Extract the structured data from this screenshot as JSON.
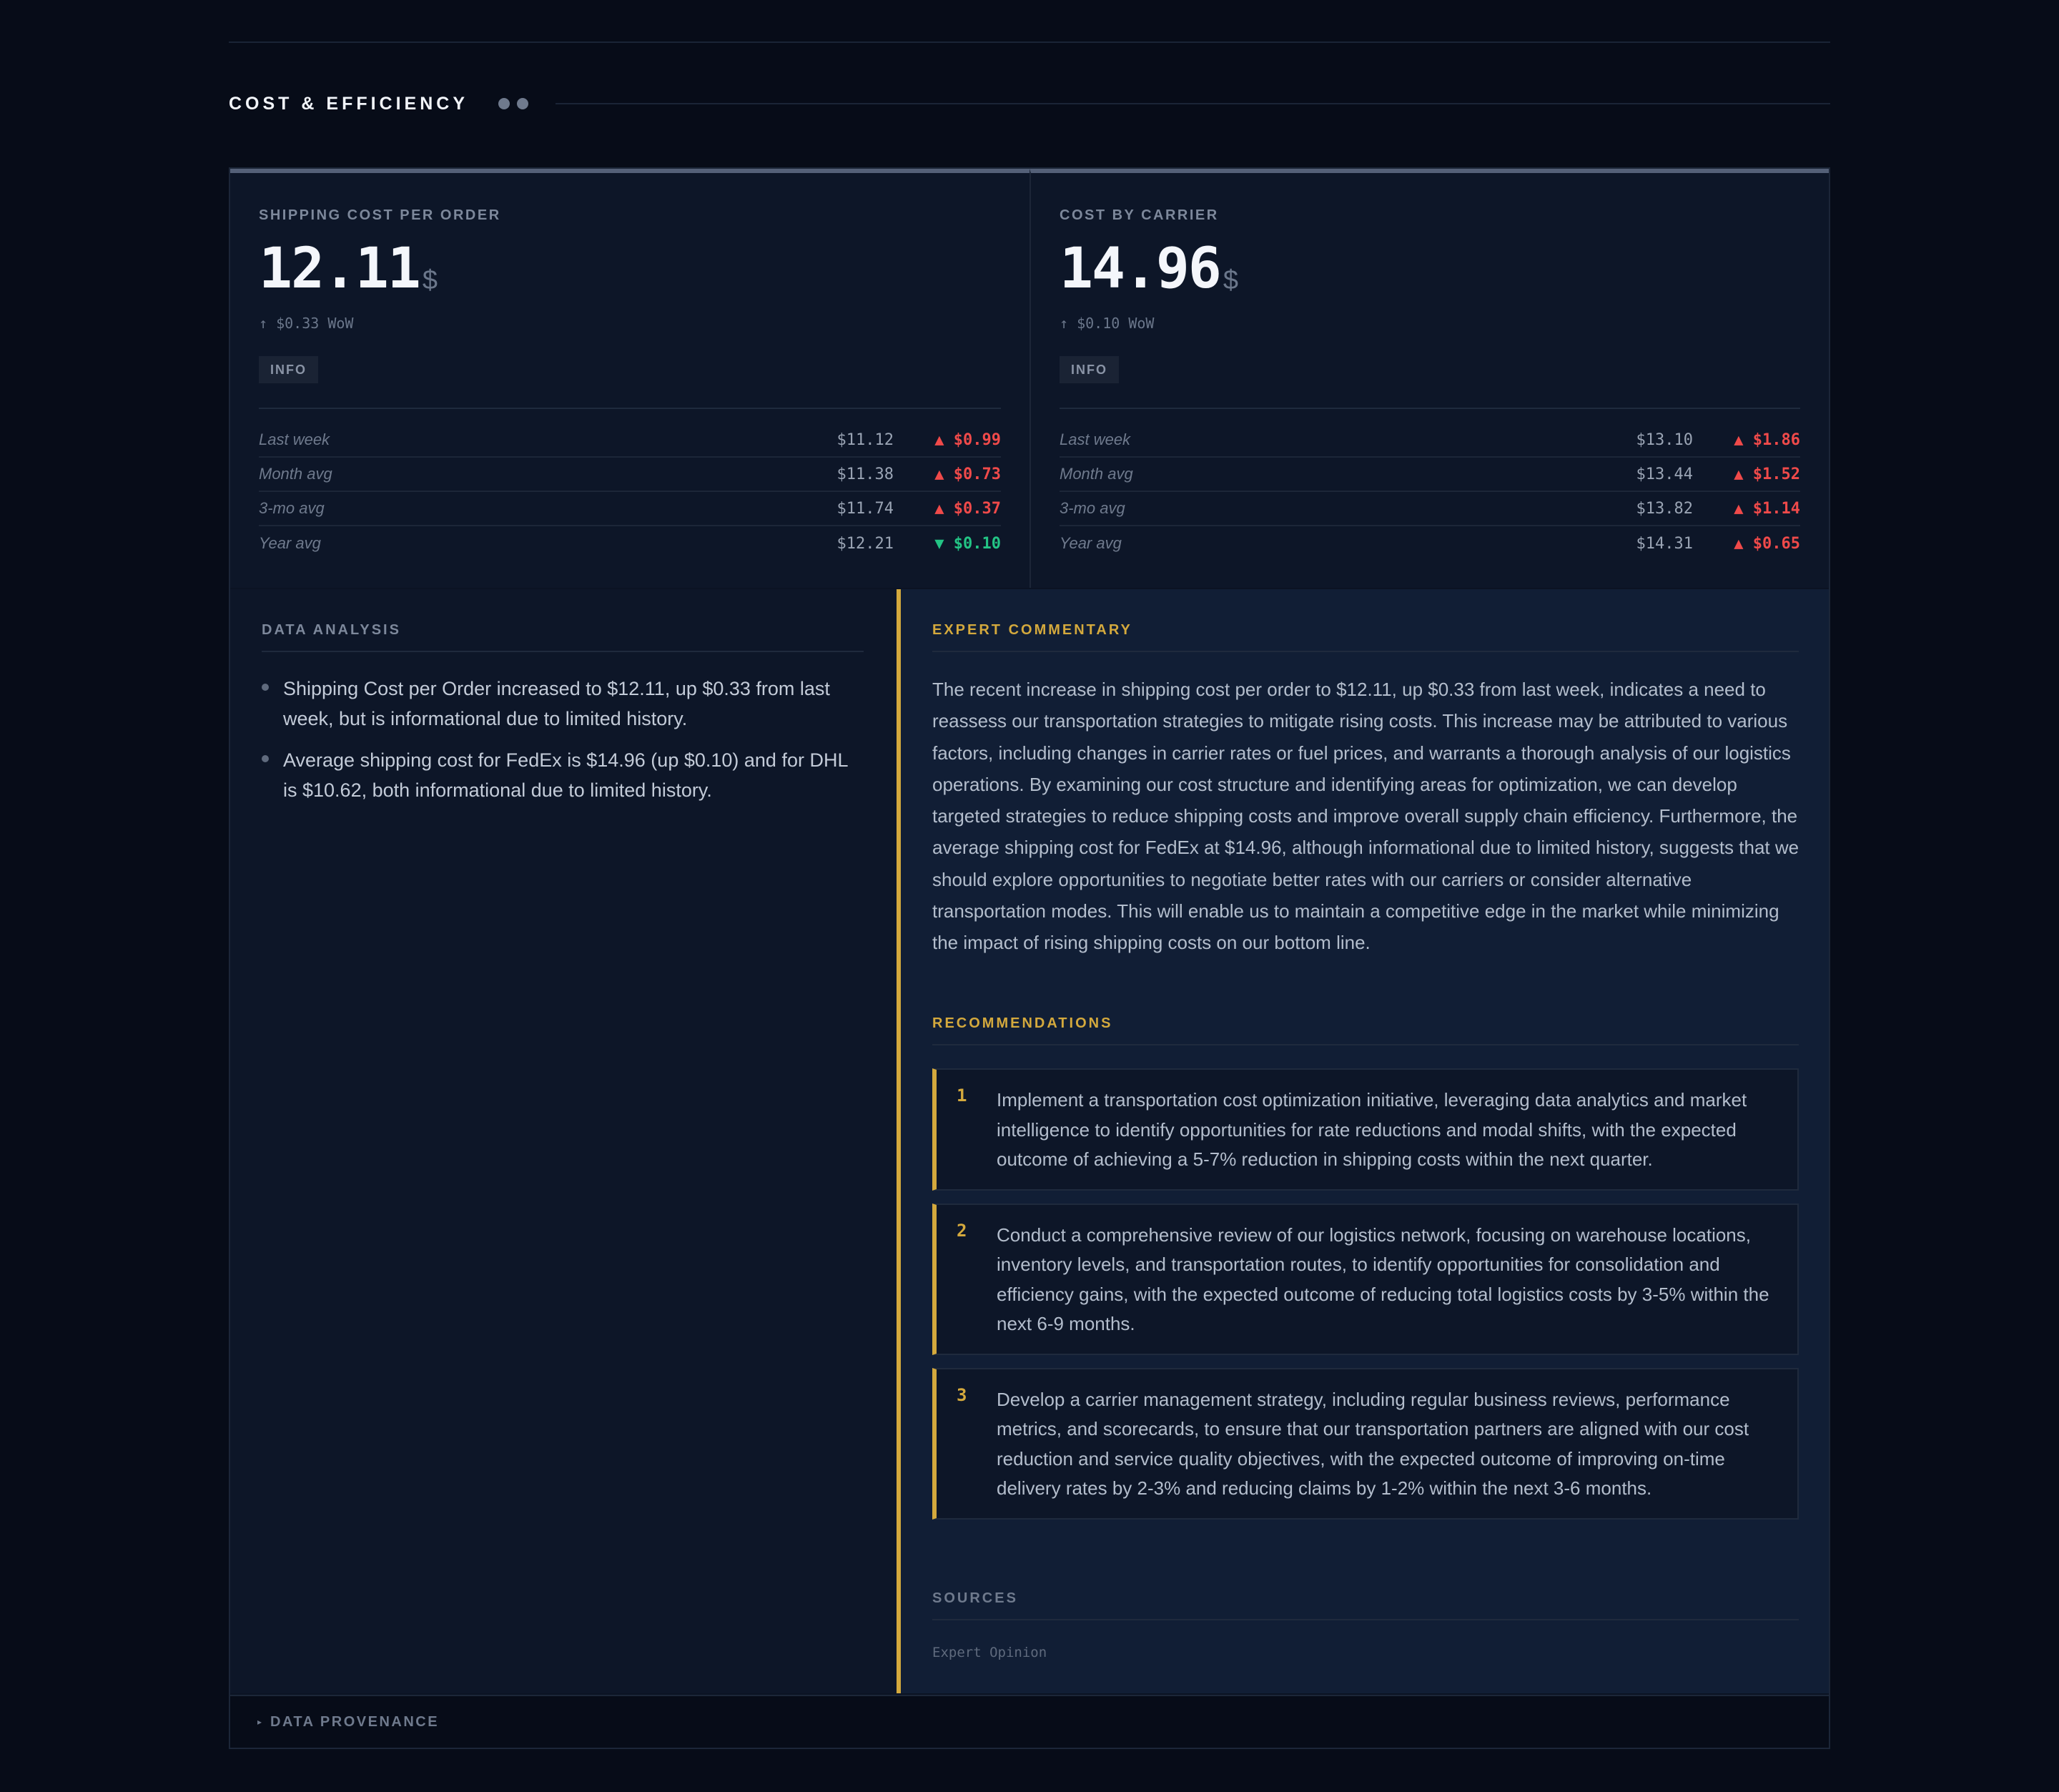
{
  "section": {
    "title": "COST & EFFICIENCY"
  },
  "kpis": [
    {
      "label": "SHIPPING COST PER ORDER",
      "value": "12.11",
      "unit": "$",
      "delta": "↑ $0.33 WoW",
      "badge": "INFO",
      "comparisons": [
        {
          "label": "Last week",
          "value": "$11.12",
          "change": "▲ $0.99",
          "direction": "up"
        },
        {
          "label": "Month avg",
          "value": "$11.38",
          "change": "▲ $0.73",
          "direction": "up"
        },
        {
          "label": "3-mo avg",
          "value": "$11.74",
          "change": "▲ $0.37",
          "direction": "up"
        },
        {
          "label": "Year avg",
          "value": "$12.21",
          "change": "▼ $0.10",
          "direction": "down"
        }
      ]
    },
    {
      "label": "COST BY CARRIER",
      "value": "14.96",
      "unit": "$",
      "delta": "↑ $0.10 WoW",
      "badge": "INFO",
      "comparisons": [
        {
          "label": "Last week",
          "value": "$13.10",
          "change": "▲ $1.86",
          "direction": "up"
        },
        {
          "label": "Month avg",
          "value": "$13.44",
          "change": "▲ $1.52",
          "direction": "up"
        },
        {
          "label": "3-mo avg",
          "value": "$13.82",
          "change": "▲ $1.14",
          "direction": "up"
        },
        {
          "label": "Year avg",
          "value": "$14.31",
          "change": "▲ $0.65",
          "direction": "up"
        }
      ]
    }
  ],
  "analysis": {
    "heading": "DATA ANALYSIS",
    "bullets": [
      "Shipping Cost per Order increased to $12.11, up $0.33 from last week, but is informational due to limited history.",
      "Average shipping cost for FedEx is $14.96 (up $0.10) and for DHL is $10.62, both informational due to limited history."
    ]
  },
  "commentary": {
    "heading": "EXPERT COMMENTARY",
    "text": "The recent increase in shipping cost per order to $12.11, up $0.33 from last week, indicates a need to reassess our transportation strategies to mitigate rising costs. This increase may be attributed to various factors, including changes in carrier rates or fuel prices, and warrants a thorough analysis of our logistics operations. By examining our cost structure and identifying areas for optimization, we can develop targeted strategies to reduce shipping costs and improve overall supply chain efficiency. Furthermore, the average shipping cost for FedEx at $14.96, although informational due to limited history, suggests that we should explore opportunities to negotiate better rates with our carriers or consider alternative transportation modes. This will enable us to maintain a competitive edge in the market while minimizing the impact of rising shipping costs on our bottom line.",
    "recommendations_heading": "RECOMMENDATIONS",
    "recommendations": [
      {
        "num": "1",
        "text": "Implement a transportation cost optimization initiative, leveraging data analytics and market intelligence to identify opportunities for rate reductions and modal shifts, with the expected outcome of achieving a 5-7% reduction in shipping costs within the next quarter."
      },
      {
        "num": "2",
        "text": "Conduct a comprehensive review of our logistics network, focusing on warehouse locations, inventory levels, and transportation routes, to identify opportunities for consolidation and efficiency gains, with the expected outcome of reducing total logistics costs by 3-5% within the next 6-9 months."
      },
      {
        "num": "3",
        "text": "Develop a carrier management strategy, including regular business reviews, performance metrics, and scorecards, to ensure that our transportation partners are aligned with our cost reduction and service quality objectives, with the expected outcome of improving on-time delivery rates by 2-3% and reducing claims by 1-2% within the next 3-6 months."
      }
    ],
    "sources_heading": "SOURCES",
    "sources": [
      "Expert Opinion"
    ]
  },
  "provenance": {
    "label": "DATA PROVENANCE",
    "icon": "caret-right-icon"
  },
  "colors": {
    "accent": "#d4a93d",
    "up": "#f04a4a",
    "down": "#23c485"
  }
}
